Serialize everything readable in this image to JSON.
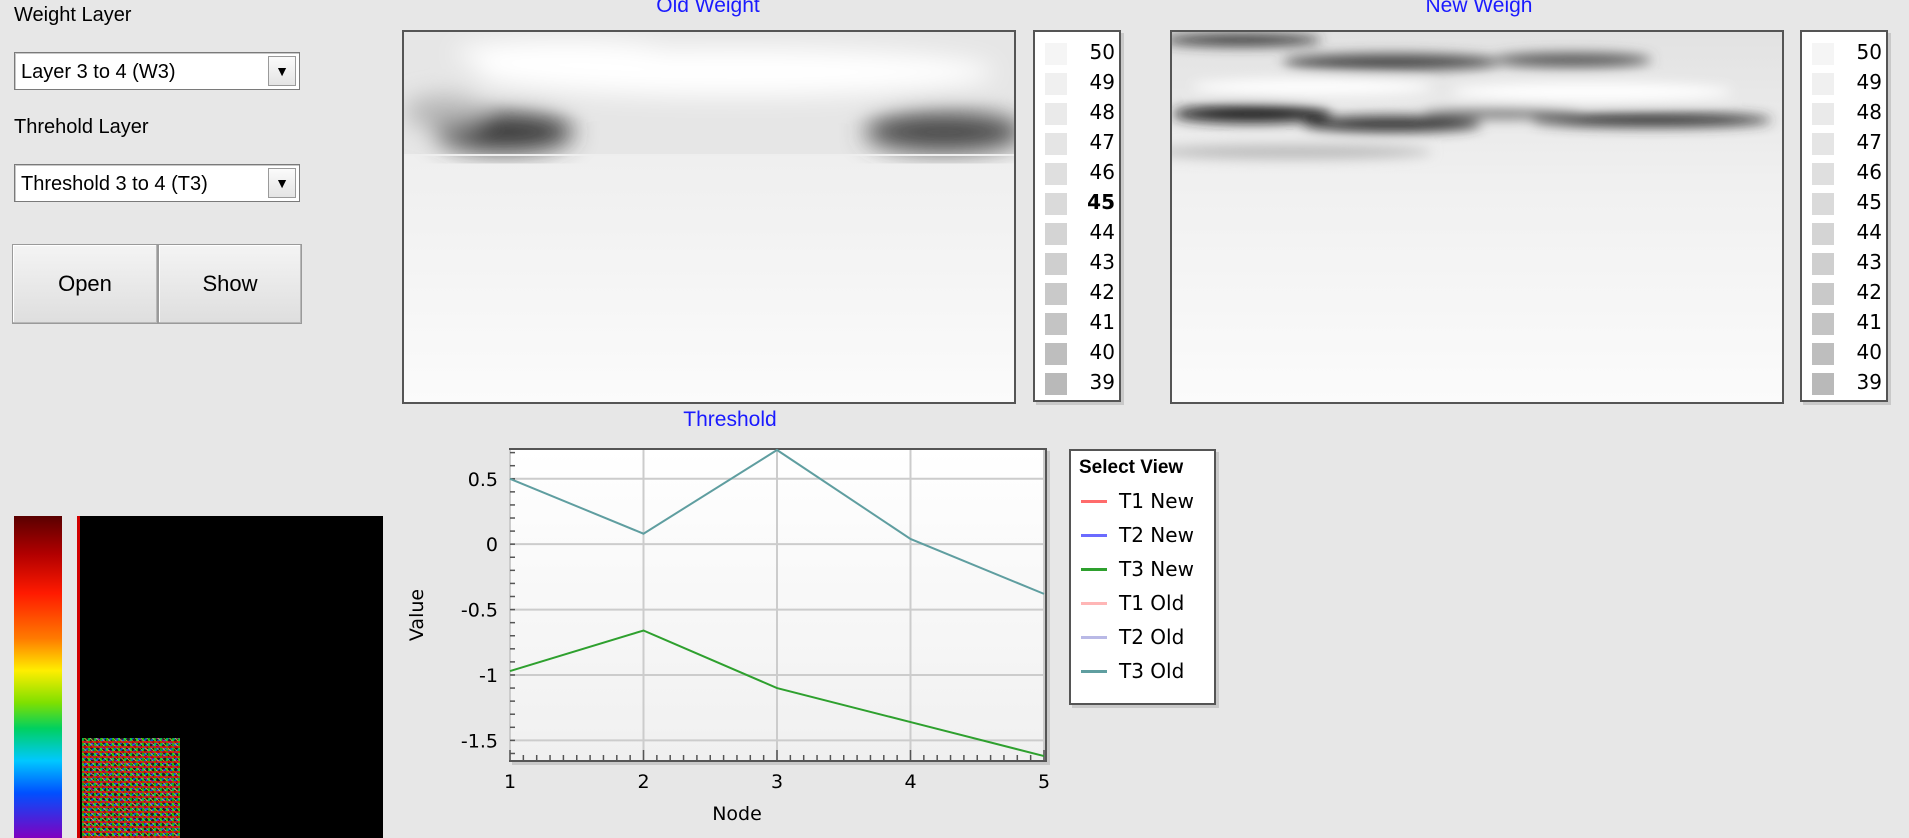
{
  "controls": {
    "weight_layer_label": "Weight Layer",
    "weight_layer_value": "Layer 3 to 4 (W3)",
    "threshold_layer_label": "Threhold Layer",
    "threshold_layer_value": "Threshold 3 to 4 (T3)",
    "open_label": "Open",
    "show_label": "Show",
    "dropdown_icon": "▼"
  },
  "old_weight": {
    "title": "Old Weight",
    "legend": [
      "50",
      "49",
      "48",
      "47",
      "46",
      "45",
      "44",
      "43",
      "42",
      "41",
      "40",
      "39"
    ],
    "highlighted": "45"
  },
  "new_weight": {
    "title": "New Weigh",
    "legend": [
      "50",
      "49",
      "48",
      "47",
      "46",
      "45",
      "44",
      "43",
      "42",
      "41",
      "40",
      "39"
    ]
  },
  "chart_data": {
    "type": "line",
    "title": "Threshold",
    "xlabel": "Node",
    "ylabel": "Value",
    "x": [
      1,
      2,
      3,
      4,
      5
    ],
    "xlim": [
      1,
      5
    ],
    "ylim": [
      -1.65,
      0.72
    ],
    "yticks": [
      0.5,
      0,
      -0.5,
      -1,
      -1.5
    ],
    "ytick_labels": [
      "0.5",
      "0",
      "-0.5",
      "-1",
      "-1.5"
    ],
    "xtick_labels": [
      "1",
      "2",
      "3",
      "4",
      "5"
    ],
    "grid": true,
    "legend_title": "Select View",
    "series": [
      {
        "name": "T1 New",
        "color": "#ff6b6b",
        "values": []
      },
      {
        "name": "T2 New",
        "color": "#6b6bff",
        "values": []
      },
      {
        "name": "T3 New",
        "color": "#2ea02e",
        "values": [
          -0.97,
          -0.66,
          -1.1,
          -1.36,
          -1.62
        ]
      },
      {
        "name": "T1 Old",
        "color": "#ffb6b6",
        "values": []
      },
      {
        "name": "T2 Old",
        "color": "#b9b9e6",
        "values": []
      },
      {
        "name": "T3 Old",
        "color": "#5f9ea0",
        "values": [
          0.5,
          0.08,
          0.72,
          0.04,
          -0.38
        ]
      }
    ]
  }
}
